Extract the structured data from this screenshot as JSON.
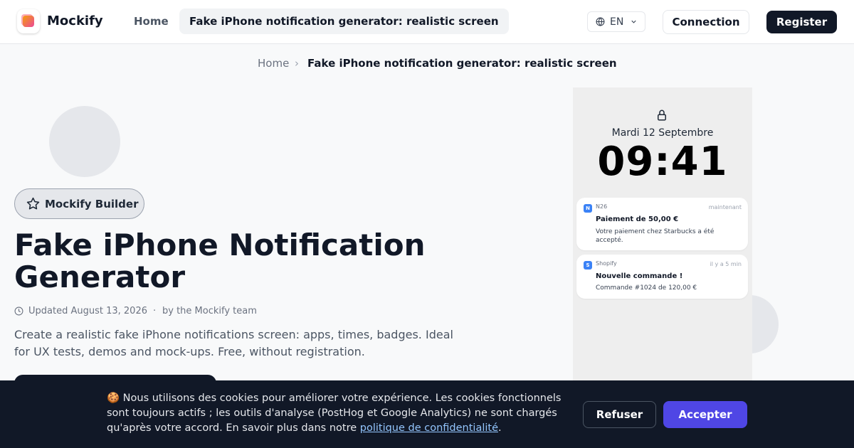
{
  "header": {
    "brand": "Mockify",
    "nav_home": "Home",
    "nav_active": "Fake iPhone notification generator: realistic screen",
    "language": "EN",
    "connection_label": "Connection",
    "register_label": "Register"
  },
  "breadcrumb": {
    "home": "Home",
    "separator": "›",
    "current": "Fake iPhone notification generator: realistic screen"
  },
  "hero": {
    "badge": "Mockify Builder",
    "title": "Fake iPhone Notification Generator",
    "updated": "Updated August 13, 2026",
    "separator": "·",
    "author": "by the Mockify team",
    "description": "Create a realistic fake iPhone notifications screen: apps, times, badges. Ideal for UX tests, demos and mock-ups. Free, without registration."
  },
  "phone": {
    "date": "Mardi 12 Septembre",
    "time": "09:41",
    "notifications": [
      {
        "app_initial": "N",
        "app": "N26",
        "when": "maintenant",
        "title": "Paiement de 50,00 €",
        "body": "Votre paiement chez Starbucks a été accepté."
      },
      {
        "app_initial": "S",
        "app": "Shopify",
        "when": "il y a 5 min",
        "title": "Nouvelle commande !",
        "body": "Commande #1024 de 120,00 €"
      }
    ]
  },
  "cookie": {
    "text": "🍪 Nous utilisons des cookies pour améliorer votre expérience. Les cookies fonctionnels sont toujours actifs ; les outils d'analyse (PostHog et Google Analytics) ne sont chargés qu'après votre accord. En savoir plus dans notre ",
    "link": "politique de confidentialité",
    "text_end": ".",
    "refuse_label": "Refuser",
    "accept_label": "Accepter"
  },
  "colors": {
    "accent": "#4f46e5",
    "dark": "#111827",
    "app_icon": "#3b82f6"
  }
}
